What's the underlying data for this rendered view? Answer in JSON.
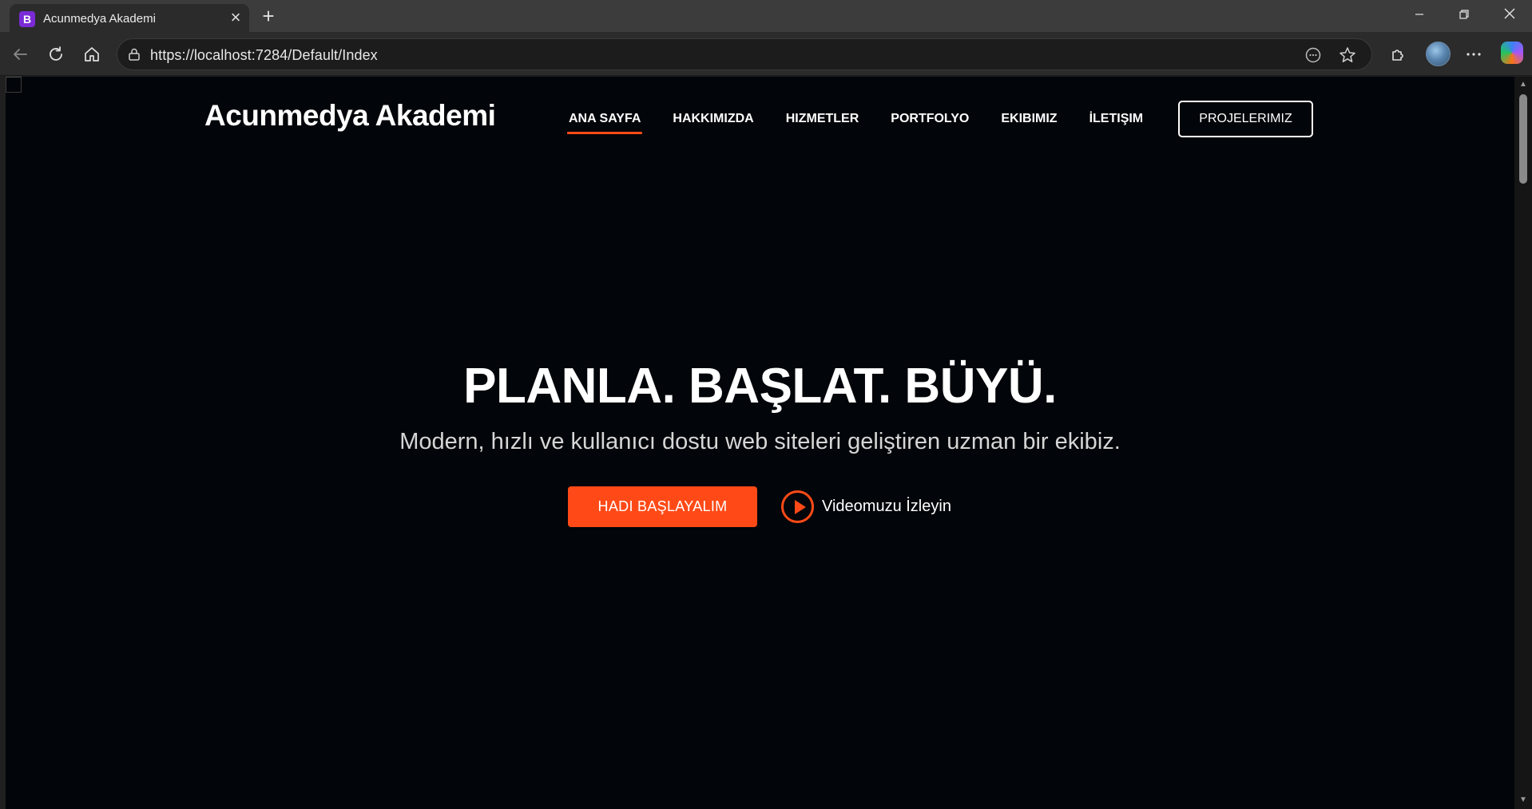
{
  "browser": {
    "tab_title": "Acunmedya Akademi",
    "favicon_letter": "B",
    "url": "https://localhost:7284/Default/Index"
  },
  "site": {
    "logo": "Acunmedya Akademi",
    "nav": [
      {
        "label": "ANA SAYFA",
        "active": true
      },
      {
        "label": "HAKKIMIZDA",
        "active": false
      },
      {
        "label": "HIZMETLER",
        "active": false
      },
      {
        "label": "PORTFOLYO",
        "active": false
      },
      {
        "label": "EKIBIMIZ",
        "active": false
      },
      {
        "label": "İLETIŞIM",
        "active": false
      }
    ],
    "projects_button": "PROJELERIMIZ"
  },
  "hero": {
    "title": "PLANLA. BAŞLAT. BÜYÜ.",
    "subtitle": "Modern, hızlı ve kullanıcı dostu web siteleri geliştiren uzman bir ekibiz.",
    "start_button": "HADI BAŞLAYALIM",
    "video_link": "Videomuzu İzleyin"
  },
  "colors": {
    "accent": "#ff4a17",
    "page_background": "#020509",
    "favicon": "#7a2bd6"
  }
}
